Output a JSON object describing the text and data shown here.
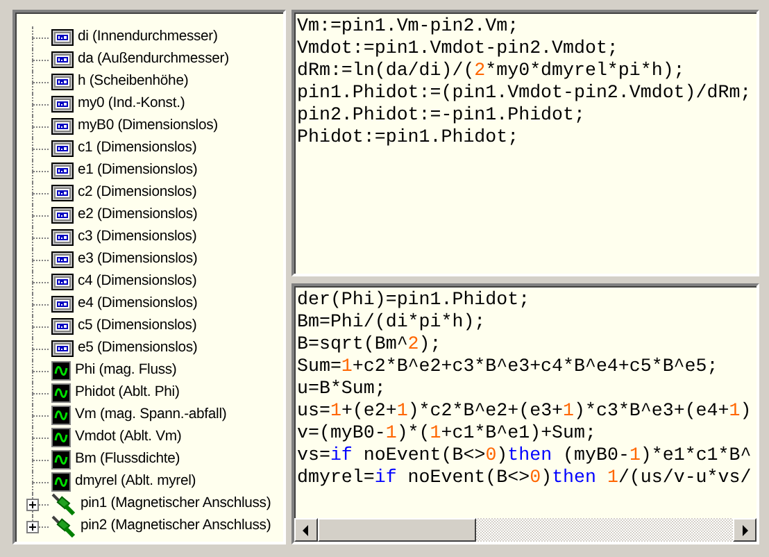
{
  "tree": [
    {
      "label": "di (Innendurchmesser)",
      "kind": "parameter"
    },
    {
      "label": "da (Außendurchmesser)",
      "kind": "parameter"
    },
    {
      "label": "h (Scheibenhöhe)",
      "kind": "parameter"
    },
    {
      "label": "my0 (Ind.-Konst.)",
      "kind": "parameter"
    },
    {
      "label": "myB0 (Dimensionslos)",
      "kind": "parameter"
    },
    {
      "label": "c1 (Dimensionslos)",
      "kind": "parameter"
    },
    {
      "label": "e1 (Dimensionslos)",
      "kind": "parameter"
    },
    {
      "label": "c2 (Dimensionslos)",
      "kind": "parameter"
    },
    {
      "label": "e2 (Dimensionslos)",
      "kind": "parameter"
    },
    {
      "label": "c3 (Dimensionslos)",
      "kind": "parameter"
    },
    {
      "label": "e3 (Dimensionslos)",
      "kind": "parameter"
    },
    {
      "label": "c4 (Dimensionslos)",
      "kind": "parameter"
    },
    {
      "label": "e4 (Dimensionslos)",
      "kind": "parameter"
    },
    {
      "label": "c5 (Dimensionslos)",
      "kind": "parameter"
    },
    {
      "label": "e5 (Dimensionslos)",
      "kind": "parameter"
    },
    {
      "label": "Phi (mag. Fluss)",
      "kind": "variable"
    },
    {
      "label": "Phidot (Ablt. Phi)",
      "kind": "variable"
    },
    {
      "label": "Vm (mag. Spann.-abfall)",
      "kind": "variable"
    },
    {
      "label": "Vmdot (Ablt. Vm)",
      "kind": "variable"
    },
    {
      "label": "Bm (Flussdichte)",
      "kind": "variable"
    },
    {
      "label": "dmyrel (Ablt. myrel)",
      "kind": "variable"
    },
    {
      "label": "pin1 (Magnetischer Anschluss)",
      "kind": "connector",
      "expanded": false
    },
    {
      "label": "pin2 (Magnetischer Anschluss)",
      "kind": "connector",
      "expanded": false
    }
  ],
  "algorithm_editor": {
    "lines": [
      [
        {
          "kind": "plain",
          "text": "Vm:=pin1.Vm-pin2.Vm;"
        }
      ],
      [
        {
          "kind": "plain",
          "text": "Vmdot:=pin1.Vmdot-pin2.Vmdot;"
        }
      ],
      [
        {
          "kind": "plain",
          "text": "dRm:=ln(da/di)/("
        },
        {
          "kind": "number",
          "text": "2"
        },
        {
          "kind": "plain",
          "text": "*my0*dmyrel*pi*h);"
        }
      ],
      [
        {
          "kind": "plain",
          "text": "pin1.Phidot:=(pin1.Vmdot-pin2.Vmdot)/dRm;"
        }
      ],
      [
        {
          "kind": "plain",
          "text": "pin2.Phidot:=-pin1.Phidot;"
        }
      ],
      [
        {
          "kind": "plain",
          "text": "Phidot:=pin1.Phidot;"
        }
      ]
    ]
  },
  "equation_editor": {
    "lines": [
      [
        {
          "kind": "plain",
          "text": "der(Phi)=pin1.Phidot;"
        }
      ],
      [
        {
          "kind": "plain",
          "text": "Bm=Phi/(di*pi*h);"
        }
      ],
      [
        {
          "kind": "plain",
          "text": "B=sqrt(Bm^"
        },
        {
          "kind": "number",
          "text": "2"
        },
        {
          "kind": "plain",
          "text": ");"
        }
      ],
      [
        {
          "kind": "plain",
          "text": "Sum="
        },
        {
          "kind": "number",
          "text": "1"
        },
        {
          "kind": "plain",
          "text": "+c2*B^e2+c3*B^e3+c4*B^e4+c5*B^e5;"
        }
      ],
      [
        {
          "kind": "plain",
          "text": "u=B*Sum;"
        }
      ],
      [
        {
          "kind": "plain",
          "text": "us="
        },
        {
          "kind": "number",
          "text": "1"
        },
        {
          "kind": "plain",
          "text": "+(e2+"
        },
        {
          "kind": "number",
          "text": "1"
        },
        {
          "kind": "plain",
          "text": ")*c2*B^e2+(e3+"
        },
        {
          "kind": "number",
          "text": "1"
        },
        {
          "kind": "plain",
          "text": ")*c3*B^e3+(e4+"
        },
        {
          "kind": "number",
          "text": "1"
        },
        {
          "kind": "plain",
          "text": ")"
        }
      ],
      [
        {
          "kind": "plain",
          "text": "v=(myB0-"
        },
        {
          "kind": "number",
          "text": "1"
        },
        {
          "kind": "plain",
          "text": ")*("
        },
        {
          "kind": "number",
          "text": "1"
        },
        {
          "kind": "plain",
          "text": "+c1*B^e1)+Sum;"
        }
      ],
      [
        {
          "kind": "plain",
          "text": "vs="
        },
        {
          "kind": "keyword",
          "text": "if"
        },
        {
          "kind": "plain",
          "text": " noEvent(B<>"
        },
        {
          "kind": "number",
          "text": "0"
        },
        {
          "kind": "plain",
          "text": ")"
        },
        {
          "kind": "keyword",
          "text": "then"
        },
        {
          "kind": "plain",
          "text": " (myB0-"
        },
        {
          "kind": "number",
          "text": "1"
        },
        {
          "kind": "plain",
          "text": ")*e1*c1*B^"
        }
      ],
      [
        {
          "kind": "plain",
          "text": "dmyrel="
        },
        {
          "kind": "keyword",
          "text": "if"
        },
        {
          "kind": "plain",
          "text": " noEvent(B<>"
        },
        {
          "kind": "number",
          "text": "0"
        },
        {
          "kind": "plain",
          "text": ")"
        },
        {
          "kind": "keyword",
          "text": "then"
        },
        {
          "kind": "number",
          "text": " 1"
        },
        {
          "kind": "plain",
          "text": "/(us/v-u*vs/"
        }
      ]
    ]
  }
}
